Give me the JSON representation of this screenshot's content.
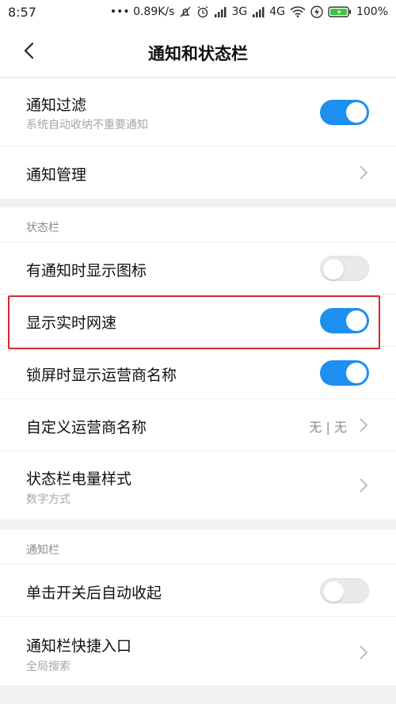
{
  "status_bar": {
    "time": "8:57",
    "speed": "••• 0.89K/s",
    "net_3g": "3G",
    "net_4g": "4G",
    "battery": "100%"
  },
  "header": {
    "title": "通知和状态栏"
  },
  "group1": {
    "notification_filter": {
      "label": "通知过滤",
      "sub": "系统自动收纳不重要通知",
      "toggle": "on"
    },
    "notification_manage": {
      "label": "通知管理"
    }
  },
  "status_section": {
    "heading": "状态栏",
    "show_icon": {
      "label": "有通知时显示图标",
      "toggle": "off"
    },
    "realtime_speed": {
      "label": "显示实时网速",
      "toggle": "on"
    },
    "lockscreen_carrier": {
      "label": "锁屏时显示运营商名称",
      "toggle": "on"
    },
    "custom_carrier": {
      "label": "自定义运营商名称",
      "value": "无 | 无"
    },
    "battery_style": {
      "label": "状态栏电量样式",
      "sub": "数字方式"
    }
  },
  "notif_section": {
    "heading": "通知栏",
    "auto_collapse": {
      "label": "单击开关后自动收起",
      "toggle": "off"
    },
    "shortcut": {
      "label": "通知栏快捷入口",
      "sub": "全局搜索"
    }
  },
  "colors": {
    "accent": "#1c8ff0",
    "highlight": "#d9262b"
  }
}
